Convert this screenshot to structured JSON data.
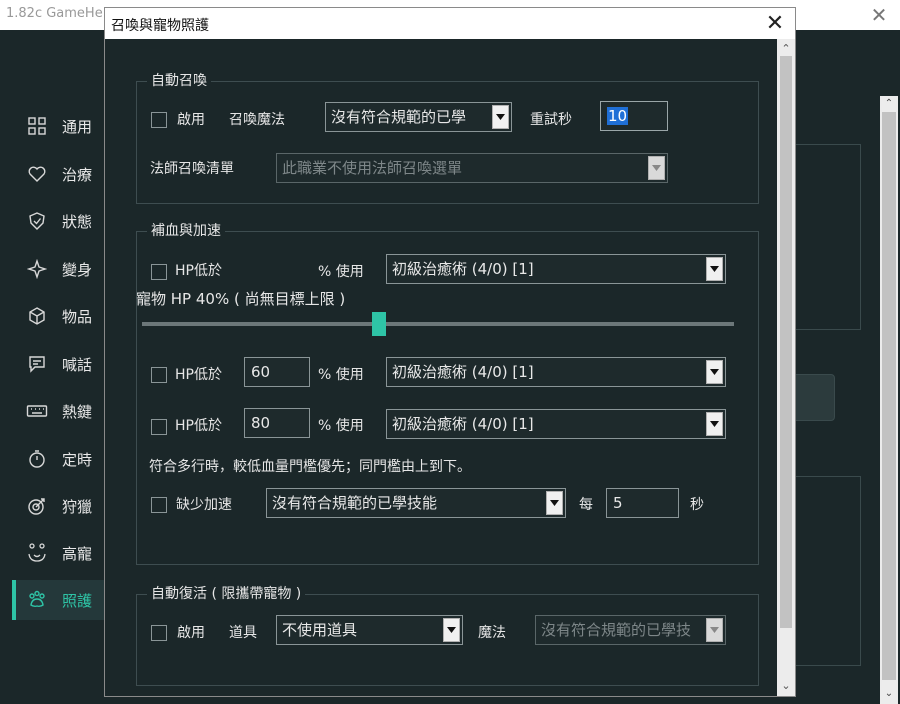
{
  "main_window": {
    "title": "1.82c GameHe",
    "close_glyph": "✕"
  },
  "sidebar": {
    "items": [
      {
        "label": "通用",
        "icon": "grid-icon"
      },
      {
        "label": "治療",
        "icon": "heart-icon"
      },
      {
        "label": "狀態",
        "icon": "shield-icon"
      },
      {
        "label": "變身",
        "icon": "sparkle-icon"
      },
      {
        "label": "物品",
        "icon": "box-icon"
      },
      {
        "label": "喊話",
        "icon": "chat-icon"
      },
      {
        "label": "熱鍵",
        "icon": "keyboard-icon"
      },
      {
        "label": "定時",
        "icon": "timer-icon"
      },
      {
        "label": "狩獵",
        "icon": "target-icon"
      },
      {
        "label": "高寵",
        "icon": "pet-face-icon"
      },
      {
        "label": "照護",
        "icon": "paw-icon",
        "active": true
      }
    ],
    "accent_color": "#2ec4a6"
  },
  "dialog": {
    "title": "召喚與寵物照護",
    "close_glyph": "✕",
    "auto_summon": {
      "group_title": "自動召喚",
      "enable_label": "啟用",
      "summon_magic_label": "召喚魔法",
      "summon_magic_value": "沒有符合規範的已學",
      "retry_label": "重試秒",
      "retry_value": "10",
      "mage_list_label": "法師召喚清單",
      "mage_list_value": "此職業不使用法師召喚選單"
    },
    "heal_haste": {
      "group_title": "補血與加速",
      "rows": [
        {
          "hp_label": "HP低於",
          "threshold": "",
          "use_label": "% 使用",
          "spell": "初級治癒術 (4/0)  [1]"
        },
        {
          "hp_label": "HP低於",
          "threshold": "60",
          "use_label": "% 使用",
          "spell": "初級治癒術 (4/0)  [1]"
        },
        {
          "hp_label": "HP低於",
          "threshold": "80",
          "use_label": "% 使用",
          "spell": "初級治癒術 (4/0)  [1]"
        }
      ],
      "pet_hp_label": "寵物 HP  40% ( 尚無目標上限 )",
      "pet_hp_fraction": 0.4,
      "note": "符合多行時，較低血量門檻優先；同門檻由上到下。",
      "haste_label": "缺少加速",
      "haste_value": "沒有符合規範的已學技能",
      "every_label": "每",
      "every_value": "5",
      "seconds_label": "秒"
    },
    "auto_revive": {
      "group_title": "自動復活 ( 限攜帶寵物 )",
      "enable_label": "啟用",
      "item_label": "道具",
      "item_value": "不使用道具",
      "magic_label": "魔法",
      "magic_value": "沒有符合規範的已學技"
    },
    "scroll_up": "⌃",
    "scroll_down": "⌄"
  },
  "bg_scroll": {
    "up": "⌃",
    "down": "⌄"
  }
}
